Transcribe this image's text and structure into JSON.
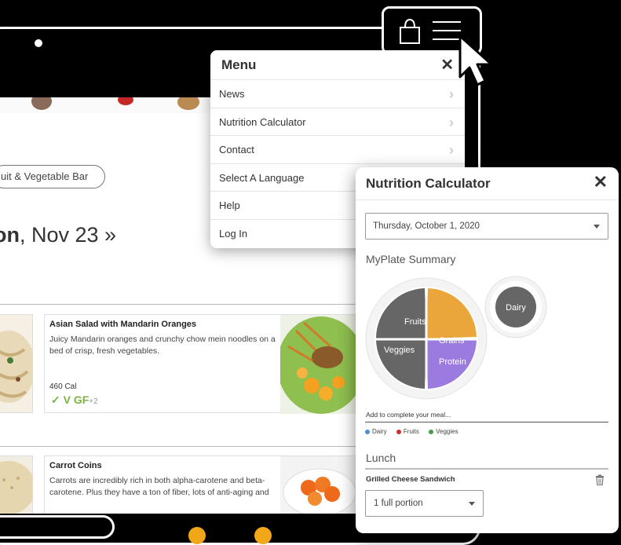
{
  "menu": {
    "title": "Menu",
    "close": "✕",
    "items": [
      {
        "label": "News"
      },
      {
        "label": "Nutrition Calculator"
      },
      {
        "label": "Contact"
      },
      {
        "label": "Select A Language"
      },
      {
        "label": "Help"
      },
      {
        "label": "Log In"
      }
    ],
    "chevron": "›"
  },
  "site": {
    "chip_label": "uit & Vegetable Bar",
    "date_heading": {
      "weekday": "on",
      "date": ", Nov 23 »"
    },
    "items": [
      {
        "title": "Asian Salad with Mandarin Oranges",
        "description": "Juicy Mandarin oranges and crunchy chow mein noodles on a bed of crisp, fresh vegetables.",
        "calories": "460 Cal",
        "diet_icons": "✓ V GF",
        "more": "+2"
      },
      {
        "title": "Carrot Coins",
        "description": "Carrots are incredibly rich in both alpha-carotene and beta-carotene. Plus they have a ton of fiber, lots of anti-aging and"
      }
    ]
  },
  "nutrition_calculator": {
    "title": "Nutrition Calculator",
    "close": "✕",
    "date_value": "Thursday, October 1, 2020",
    "summary_label": "MyPlate Summary",
    "plate": {
      "segments": [
        {
          "label": "Fruits",
          "color": "#666666"
        },
        {
          "label": "Grains",
          "color": "#EAA63B"
        },
        {
          "label": "Veggies",
          "color": "#666666"
        },
        {
          "label": "Protein",
          "color": "#9C7BE0"
        }
      ],
      "dairy_label": "Dairy"
    },
    "meal_note": "Add to complete your meal...",
    "legend": [
      {
        "label": "Dairy",
        "color": "#4a90d9"
      },
      {
        "label": "Fruits",
        "color": "#d32f2f"
      },
      {
        "label": "Veggies",
        "color": "#43a047"
      }
    ],
    "lunch_label": "Lunch",
    "lunch_item": "Grilled Cheese Sandwich",
    "portion_value": "1 full portion"
  }
}
